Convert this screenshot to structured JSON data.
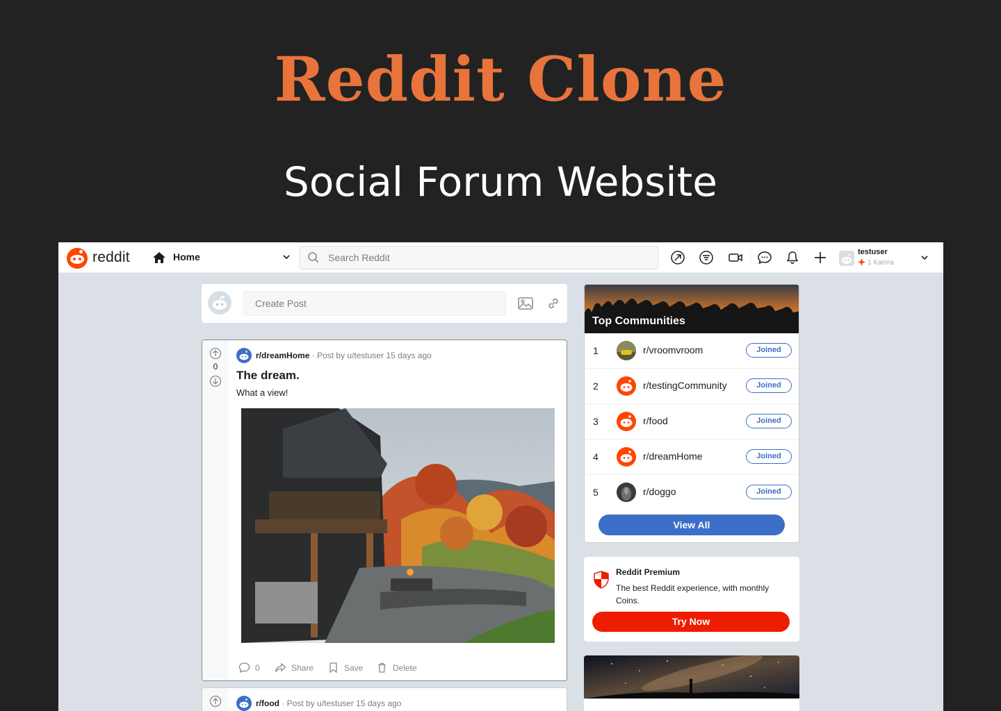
{
  "hero": {
    "title": "Reddit Clone",
    "subtitle": "Social Forum Website"
  },
  "topbar": {
    "wordmark": "reddit",
    "home_label": "Home",
    "search_placeholder": "Search Reddit",
    "icons": [
      "popular-arrow-icon",
      "filter-icon",
      "video-icon",
      "chat-icon",
      "bell-icon",
      "plus-icon"
    ],
    "user": {
      "name": "testuser",
      "karma": "1 Karma"
    }
  },
  "create_post": {
    "placeholder": "Create Post"
  },
  "posts": [
    {
      "subreddit": "r/dreamHome",
      "meta": "· Post by u/testuser 15 days ago",
      "votes": "0",
      "title": "The dream.",
      "body": "What a view!",
      "comments": "0",
      "share": "Share",
      "save": "Save",
      "delete": "Delete"
    },
    {
      "subreddit": "r/food",
      "meta": "· Post by u/testuser 15 days ago"
    }
  ],
  "communities": {
    "title": "Top Communities",
    "items": [
      {
        "rank": "1",
        "name": "r/vroomvroom",
        "button": "Joined"
      },
      {
        "rank": "2",
        "name": "r/testingCommunity",
        "button": "Joined"
      },
      {
        "rank": "3",
        "name": "r/food",
        "button": "Joined"
      },
      {
        "rank": "4",
        "name": "r/dreamHome",
        "button": "Joined"
      },
      {
        "rank": "5",
        "name": "r/doggo",
        "button": "Joined"
      }
    ],
    "view_all": "View All"
  },
  "premium": {
    "title": "Reddit Premium",
    "description": "The best Reddit experience, with monthly Coins.",
    "button": "Try Now"
  },
  "colors": {
    "accent": "#e8743b",
    "reddit_orange": "#ff4500",
    "blue": "#3b6ec7",
    "premium_red": "#ee1c00"
  }
}
